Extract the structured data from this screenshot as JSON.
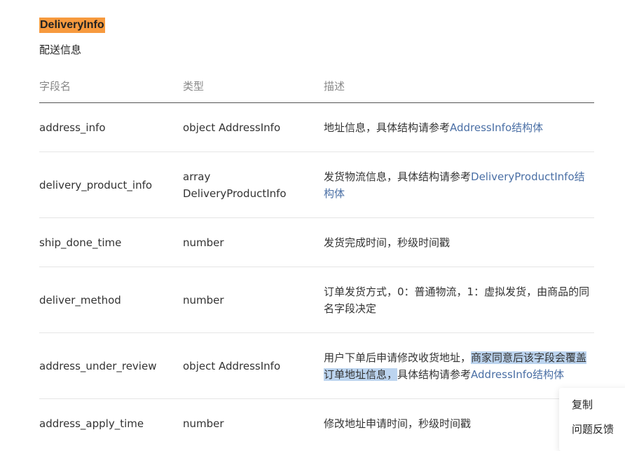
{
  "section": {
    "title": "DeliveryInfo",
    "subtitle": "配送信息"
  },
  "table": {
    "headers": [
      "字段名",
      "类型",
      "描述"
    ],
    "rows": [
      {
        "name": "address_info",
        "type_l1": "object AddressInfo",
        "type_l2": "",
        "desc_l1": "地址信息，具体结构请参考",
        "desc_link1": "AddressInfo结构体",
        "desc_l2": "",
        "desc_link2": ""
      },
      {
        "name": "delivery_product_info",
        "type_l1": "array",
        "type_l2": "DeliveryProductInfo",
        "desc_l1": "发货物流信息，具体结构请参考",
        "desc_link1": "DeliveryProductInfo结",
        "desc_l2": "",
        "desc_link2": "构体"
      },
      {
        "name": "ship_done_time",
        "type_l1": "number",
        "type_l2": "",
        "desc_l1": "发货完成时间，秒级时间戳",
        "desc_link1": "",
        "desc_l2": "",
        "desc_link2": ""
      },
      {
        "name": "deliver_method",
        "type_l1": "number",
        "type_l2": "",
        "desc_l1": "订单发货方式，0：普通物流，1：虚拟发货，由商品的同",
        "desc_link1": "",
        "desc_l2": "名字段决定",
        "desc_link2": ""
      },
      {
        "name": "address_under_review",
        "type_l1": "object AddressInfo",
        "type_l2": "",
        "desc_l1": "用户下单后申请修改收货地址，",
        "desc_hl1": "商家同意后该字段会覆盖",
        "desc_hl2": "订单地址信息，",
        "desc_l2": "具体结构请参考",
        "desc_link2": "AddressInfo结构体"
      },
      {
        "name": "address_apply_time",
        "type_l1": "number",
        "type_l2": "",
        "desc_l1": "修改地址申请时间，秒级时间戳",
        "desc_link1": "",
        "desc_l2": "",
        "desc_link2": ""
      }
    ]
  },
  "context_menu": {
    "items": [
      "复制",
      "问题反馈"
    ]
  },
  "colors": {
    "heading_highlight": "#f79a3e",
    "link": "#4a6fa5",
    "selection": "#bcd4ef"
  }
}
